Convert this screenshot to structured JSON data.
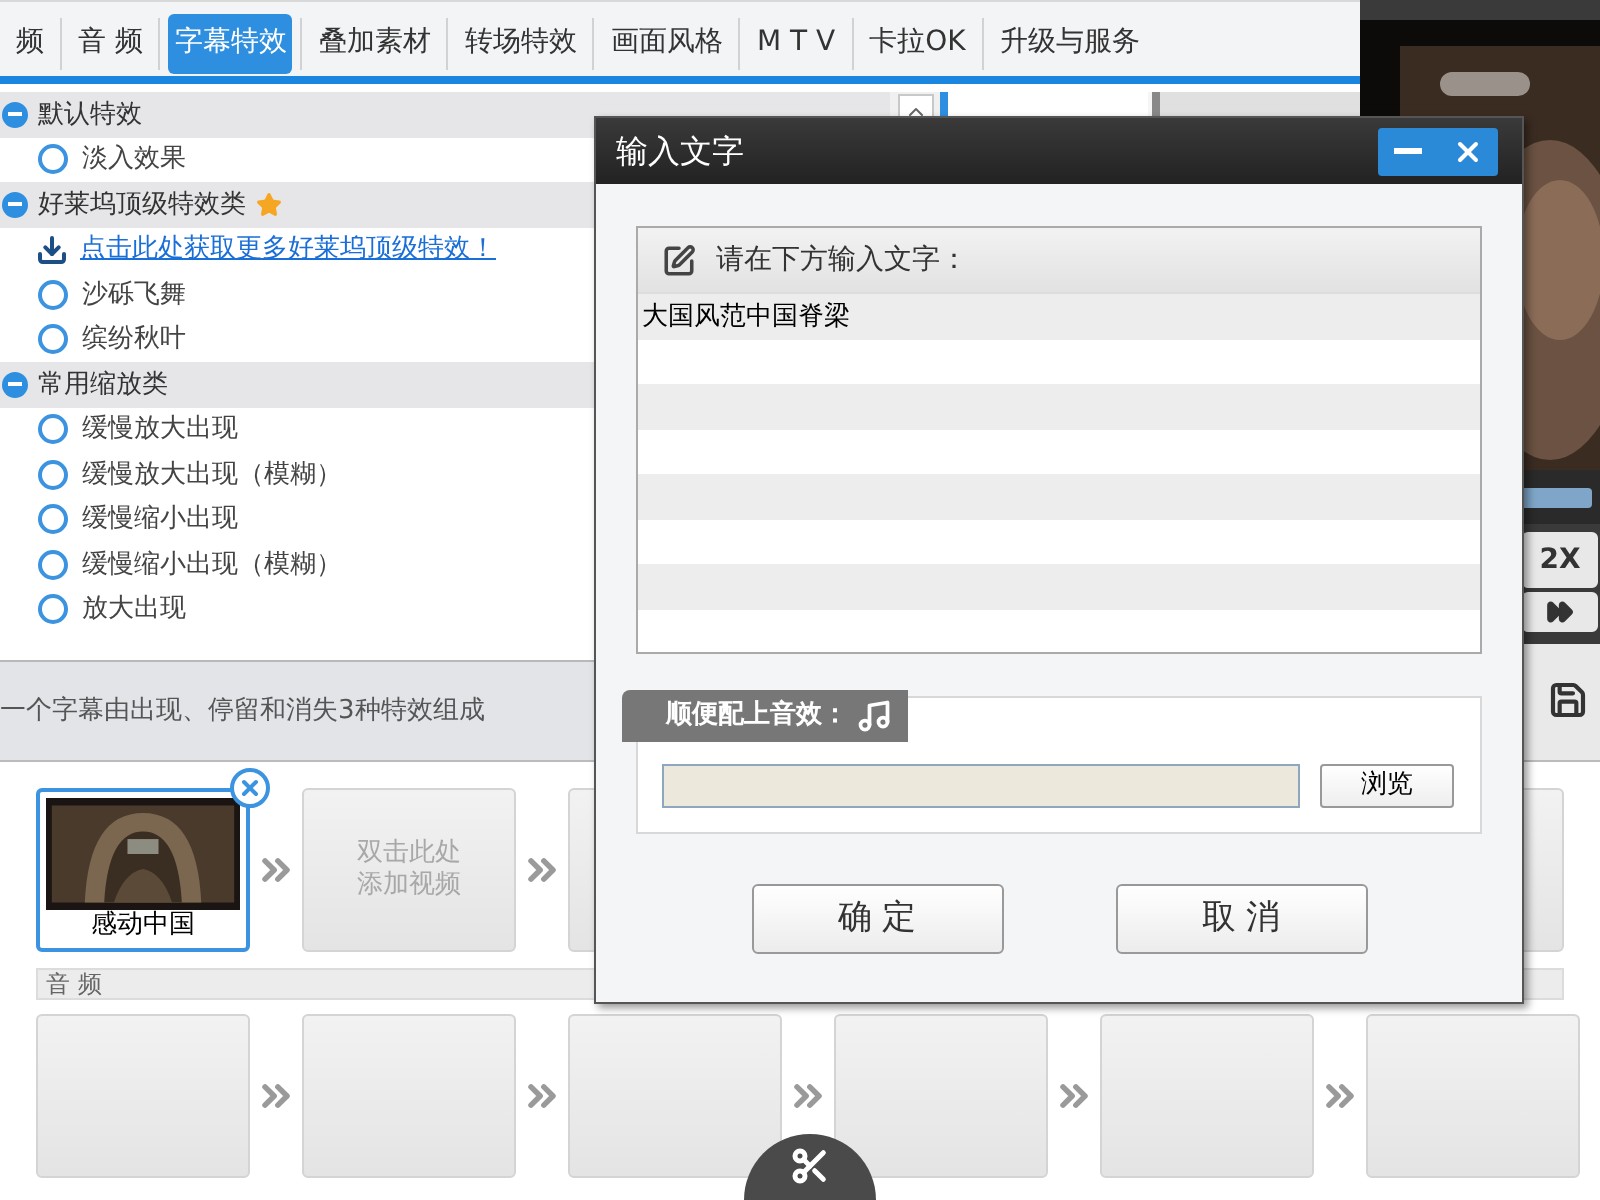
{
  "tabs": [
    {
      "label": "频",
      "selected": false
    },
    {
      "label": "音 频",
      "selected": false
    },
    {
      "label": "字幕特效",
      "selected": true
    },
    {
      "label": "叠加素材",
      "selected": false
    },
    {
      "label": "转场特效",
      "selected": false
    },
    {
      "label": "画面风格",
      "selected": false
    },
    {
      "label": "M T V",
      "selected": false
    },
    {
      "label": "卡拉OK",
      "selected": false
    },
    {
      "label": "升级与服务",
      "selected": false
    }
  ],
  "effect_groups": [
    {
      "title": "默认特效",
      "expanded": true,
      "featured": false,
      "items": [
        {
          "kind": "radio",
          "label": "淡入效果",
          "selected": false
        }
      ]
    },
    {
      "title": "好莱坞顶级特效类",
      "expanded": true,
      "featured": true,
      "items": [
        {
          "kind": "link",
          "label": "点击此处获取更多好莱坞顶级特效！"
        },
        {
          "kind": "radio",
          "label": "沙砾飞舞",
          "selected": false
        },
        {
          "kind": "radio",
          "label": "缤纷秋叶",
          "selected": false
        }
      ]
    },
    {
      "title": "常用缩放类",
      "expanded": true,
      "featured": false,
      "items": [
        {
          "kind": "radio",
          "label": "缓慢放大出现",
          "selected": false
        },
        {
          "kind": "radio",
          "label": "缓慢放大出现（模糊）",
          "selected": false
        },
        {
          "kind": "radio",
          "label": "缓慢缩小出现",
          "selected": false
        },
        {
          "kind": "radio",
          "label": "缓慢缩小出现（模糊）",
          "selected": false
        },
        {
          "kind": "radio",
          "label": "放大出现",
          "selected": false
        }
      ]
    }
  ],
  "hint": "一个字幕由出现、停留和消失3种特效组成",
  "preview": {
    "speed_label": "2X"
  },
  "timeline": {
    "video_clips": [
      {
        "kind": "clip",
        "label": "感动中国",
        "selected": true
      },
      {
        "kind": "placeholder",
        "lines": [
          "双击此处",
          "添加视频"
        ]
      },
      {
        "kind": "empty"
      },
      {
        "kind": "empty"
      }
    ],
    "audio_label": "音 频",
    "audio_clips": [
      {
        "kind": "empty"
      },
      {
        "kind": "empty"
      },
      {
        "kind": "empty"
      },
      {
        "kind": "empty"
      },
      {
        "kind": "empty"
      },
      {
        "kind": "empty"
      }
    ]
  },
  "dialog": {
    "title": "输入文字",
    "prompt": "请在下方输入文字：",
    "text_value": "大国风范中国脊梁",
    "sound_label": "顺便配上音效：",
    "browse": "浏览",
    "buttons": [
      "确 定",
      "取 消"
    ]
  }
}
